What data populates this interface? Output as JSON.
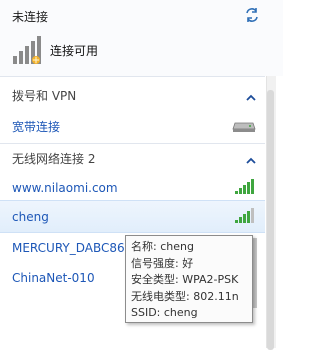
{
  "header": {
    "title": "未连接",
    "status": "连接可用"
  },
  "sections": [
    {
      "title": "拨号和 VPN",
      "items": [
        {
          "label": "宽带连接"
        }
      ]
    },
    {
      "title": "无线网络连接 2",
      "items": [
        {
          "label": "www.nilaomi.com"
        },
        {
          "label": "cheng"
        },
        {
          "label": "MERCURY_DABC86"
        },
        {
          "label": "ChinaNet-010"
        }
      ]
    }
  ],
  "tooltip": {
    "lines": [
      "名称: cheng",
      "信号强度: 好",
      "安全类型: WPA2-PSK",
      "无线电类型: 802.11n",
      "SSID: cheng"
    ]
  },
  "colors": {
    "link": "#1d57b7",
    "signal": "#3fa63f",
    "selected_bg": "#e6f0fb"
  },
  "icons": [
    "refresh-icon",
    "network-bars-icon",
    "broadband-icon",
    "wifi-signal-icon",
    "collapse-caret-icon"
  ]
}
